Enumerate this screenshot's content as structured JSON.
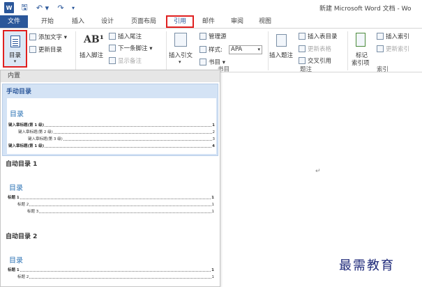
{
  "window": {
    "title": "新建 Microsoft Word 文档 - Wo",
    "quick_access": {
      "app_icon": "W",
      "save": "🖫",
      "undo": "↶ ▾",
      "redo": "↷",
      "more": "▾"
    }
  },
  "tabs": {
    "file": "文件",
    "start": "开始",
    "insert": "插入",
    "design": "设计",
    "layout": "页面布局",
    "references": "引用",
    "mailings": "邮件",
    "review": "审阅",
    "view": "视图"
  },
  "ribbon": {
    "toc": {
      "label": "目录",
      "arrow": "▾",
      "add_text": "添加文字 ▾",
      "update": "更新目录"
    },
    "footnotes": {
      "ab_glyph": "AB¹",
      "insert_footnote": "插入脚注",
      "insert_endnote": "插入尾注",
      "next_footnote": "下一条脚注 ▾",
      "show_notes": "显示备注"
    },
    "citations": {
      "insert_citation": "插入引文",
      "insert_citation_arrow": "▾",
      "manage_sources": "管理源",
      "style_label": "样式:",
      "style_value": "APA",
      "style_arrow": "▾",
      "bibliography": "书目 ▾",
      "group_label": "书目"
    },
    "captions": {
      "insert_caption": "插入题注",
      "insert_table_of_figures": "插入表目录",
      "update_table": "更新表格",
      "cross_reference": "交叉引用",
      "group_label": "题注"
    },
    "index": {
      "mark_entry": "标记\n索引项",
      "mark_entry_line1": "标记",
      "mark_entry_line2": "索引项",
      "insert_index": "插入索引",
      "update_index": "更新索引",
      "group_label": "索引"
    }
  },
  "dropdown": {
    "section_header": "内置",
    "items": [
      {
        "title": "手动目录",
        "heading": "目录",
        "lines": [
          {
            "text": "键入章标题(第 1 级)",
            "page": "1"
          },
          {
            "text": "键入章标题(第 2 级)",
            "page": "2"
          },
          {
            "text": "键入章标题(第 3 级)",
            "page": "3"
          },
          {
            "text": "键入章标题(第 1 级)",
            "page": "4"
          }
        ]
      },
      {
        "title": "自动目录 1",
        "heading": "目录",
        "lines": [
          {
            "text": "标题 1",
            "page": "1"
          },
          {
            "text": "标题 2",
            "page": "1"
          },
          {
            "text": "标题 3",
            "page": "1"
          }
        ]
      },
      {
        "title": "自动目录 2",
        "heading": "目录",
        "lines": [
          {
            "text": "标题 1",
            "page": "1"
          },
          {
            "text": "标题 2",
            "page": "1"
          }
        ]
      }
    ]
  },
  "document": {
    "paragraph_mark": "↵"
  },
  "watermark": "最需教育",
  "colors": {
    "accent": "#2b579a",
    "highlight_border": "#e02020",
    "selected_item": "#d4e3f5"
  }
}
